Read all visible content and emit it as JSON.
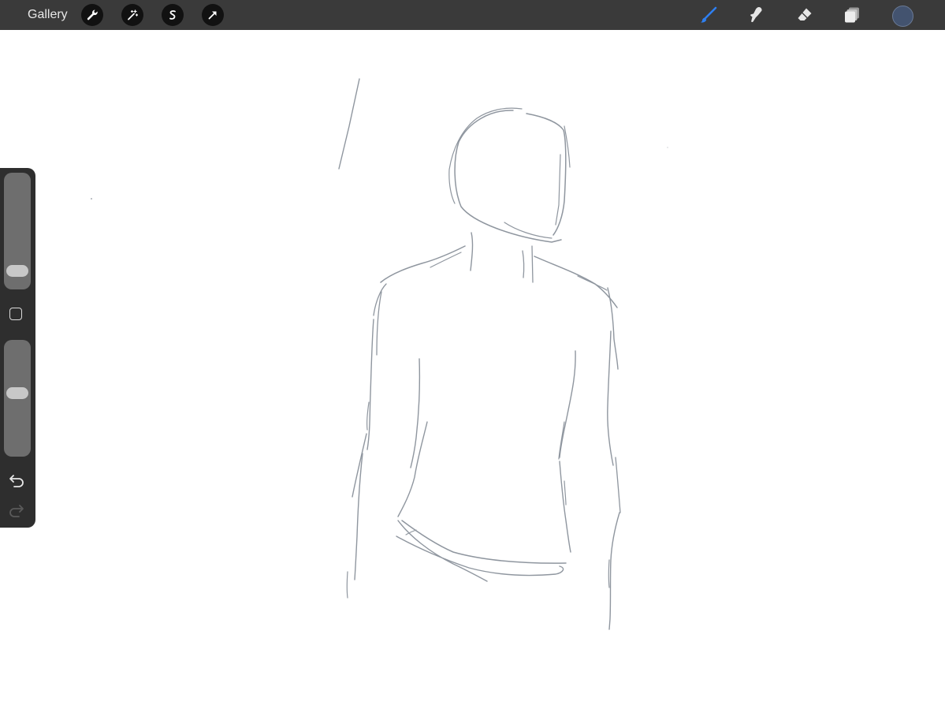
{
  "topbar": {
    "gallery_label": "Gallery",
    "action_icons": [
      "wrench-icon",
      "magic-wand-icon",
      "selection-s-icon",
      "transform-arrow-icon"
    ],
    "tools": [
      "brush-icon",
      "smudge-icon",
      "eraser-icon",
      "layers-icon"
    ],
    "active_tool": "brush-icon",
    "active_tool_color": "#2e7ff0",
    "current_color": "#43536f"
  },
  "sidebar": {
    "brush_size_level": 0.1,
    "opacity_level": 0.55,
    "icons": [
      "modify-square-icon",
      "undo-icon",
      "redo-icon"
    ]
  },
  "canvas": {
    "background": "#ffffff",
    "stroke_color": "#8f969f"
  }
}
